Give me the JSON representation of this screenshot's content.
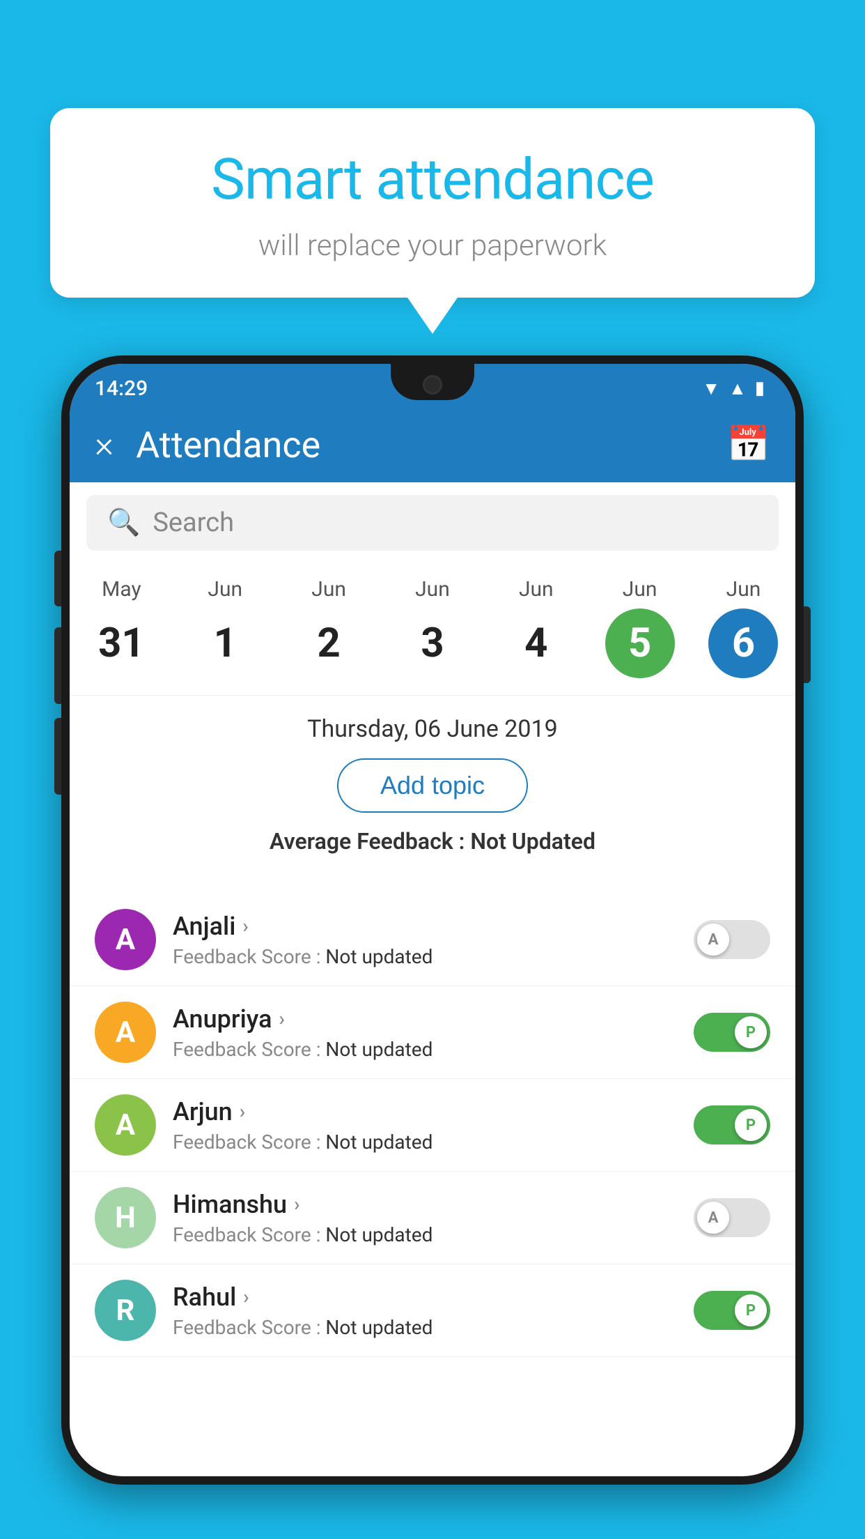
{
  "background_color": "#1ab8e8",
  "bubble": {
    "title": "Smart attendance",
    "subtitle": "will replace your paperwork"
  },
  "status_bar": {
    "time": "14:29",
    "wifi": "▼",
    "signal": "▲",
    "battery": "▮"
  },
  "app_bar": {
    "title": "Attendance",
    "close_label": "×",
    "calendar_icon": "📅"
  },
  "search": {
    "placeholder": "Search"
  },
  "calendar": {
    "days": [
      {
        "month": "May",
        "date": "31",
        "type": "normal"
      },
      {
        "month": "Jun",
        "date": "1",
        "type": "normal"
      },
      {
        "month": "Jun",
        "date": "2",
        "type": "normal"
      },
      {
        "month": "Jun",
        "date": "3",
        "type": "normal"
      },
      {
        "month": "Jun",
        "date": "4",
        "type": "normal"
      },
      {
        "month": "Jun",
        "date": "5",
        "type": "today"
      },
      {
        "month": "Jun",
        "date": "6",
        "type": "selected"
      }
    ]
  },
  "selected_date": "Thursday, 06 June 2019",
  "add_topic_label": "Add topic",
  "average_feedback": {
    "label": "Average Feedback : ",
    "value": "Not Updated"
  },
  "students": [
    {
      "name": "Anjali",
      "avatar_letter": "A",
      "avatar_color": "#9c27b0",
      "feedback_label": "Feedback Score : ",
      "feedback_value": "Not updated",
      "toggle": "off",
      "toggle_letter": "A"
    },
    {
      "name": "Anupriya",
      "avatar_letter": "A",
      "avatar_color": "#f9a825",
      "feedback_label": "Feedback Score : ",
      "feedback_value": "Not updated",
      "toggle": "on",
      "toggle_letter": "P"
    },
    {
      "name": "Arjun",
      "avatar_letter": "A",
      "avatar_color": "#8bc34a",
      "feedback_label": "Feedback Score : ",
      "feedback_value": "Not updated",
      "toggle": "on",
      "toggle_letter": "P"
    },
    {
      "name": "Himanshu",
      "avatar_letter": "H",
      "avatar_color": "#a5d6a7",
      "feedback_label": "Feedback Score : ",
      "feedback_value": "Not updated",
      "toggle": "off",
      "toggle_letter": "A"
    },
    {
      "name": "Rahul",
      "avatar_letter": "R",
      "avatar_color": "#4db6ac",
      "feedback_label": "Feedback Score : ",
      "feedback_value": "Not updated",
      "toggle": "on",
      "toggle_letter": "P"
    }
  ]
}
